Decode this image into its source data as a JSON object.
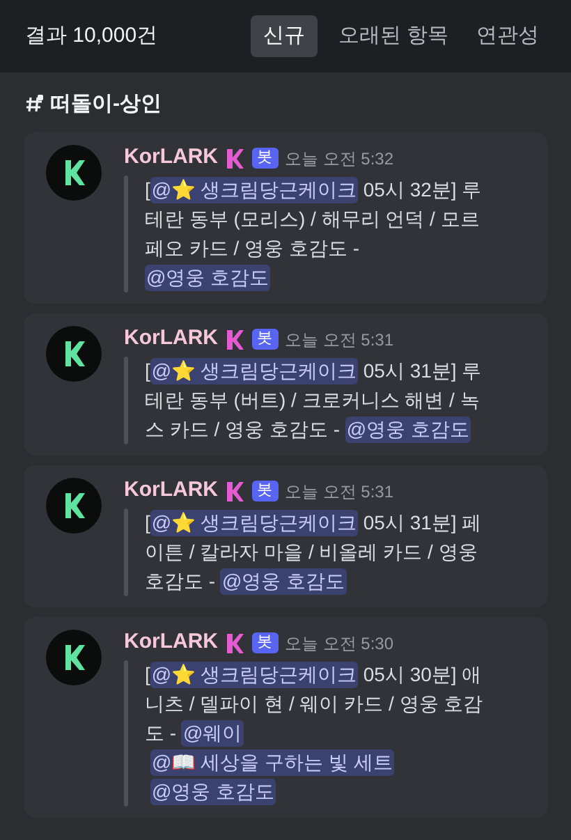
{
  "header": {
    "result_count": "결과 10,000건",
    "tabs": [
      {
        "label": "신규",
        "selected": true
      },
      {
        "label": "오래된 항목",
        "selected": false
      },
      {
        "label": "연관성",
        "selected": false
      }
    ]
  },
  "channel": {
    "name": "떠돌이-상인"
  },
  "messages": [
    {
      "author": "KorLARK",
      "badge": "봇",
      "time": "오늘 오전 5:32",
      "parts": [
        {
          "kind": "text",
          "text": "["
        },
        {
          "kind": "mention",
          "text": "@⭐ 생크림당근케이크"
        },
        {
          "kind": "text",
          "text": " 05시 32분] 루테란 동부 (모리스) / 해무리 언덕 / 모르페오 카드 / 영웅 호감도 - "
        },
        {
          "kind": "mention",
          "text": "@영웅 호감도"
        }
      ]
    },
    {
      "author": "KorLARK",
      "badge": "봇",
      "time": "오늘 오전 5:31",
      "parts": [
        {
          "kind": "text",
          "text": "["
        },
        {
          "kind": "mention",
          "text": "@⭐ 생크림당근케이크"
        },
        {
          "kind": "text",
          "text": " 05시 31분] 루테란 동부 (버트) / 크로커니스 해변 / 녹스 카드 / 영웅 호감도 - "
        },
        {
          "kind": "mention",
          "text": "@영웅 호감도"
        }
      ]
    },
    {
      "author": "KorLARK",
      "badge": "봇",
      "time": "오늘 오전 5:31",
      "parts": [
        {
          "kind": "text",
          "text": "["
        },
        {
          "kind": "mention",
          "text": "@⭐ 생크림당근케이크"
        },
        {
          "kind": "text",
          "text": " 05시 31분] 페이튼 / 칼라자 마을 / 비올레 카드 / 영웅 호감도 - "
        },
        {
          "kind": "mention",
          "text": "@영웅 호감도"
        }
      ]
    },
    {
      "author": "KorLARK",
      "badge": "봇",
      "time": "오늘 오전 5:30",
      "parts": [
        {
          "kind": "text",
          "text": "["
        },
        {
          "kind": "mention",
          "text": "@⭐ 생크림당근케이크"
        },
        {
          "kind": "text",
          "text": " 05시 30분] 애니츠 / 델파이 현 / 웨이 카드 / 영웅 호감도 - "
        },
        {
          "kind": "mention",
          "text": "@웨이"
        },
        {
          "kind": "mention",
          "text": "@📖 세상을 구하는 빛 세트"
        },
        {
          "kind": "mention",
          "text": "@영웅 호감도"
        }
      ]
    }
  ]
}
